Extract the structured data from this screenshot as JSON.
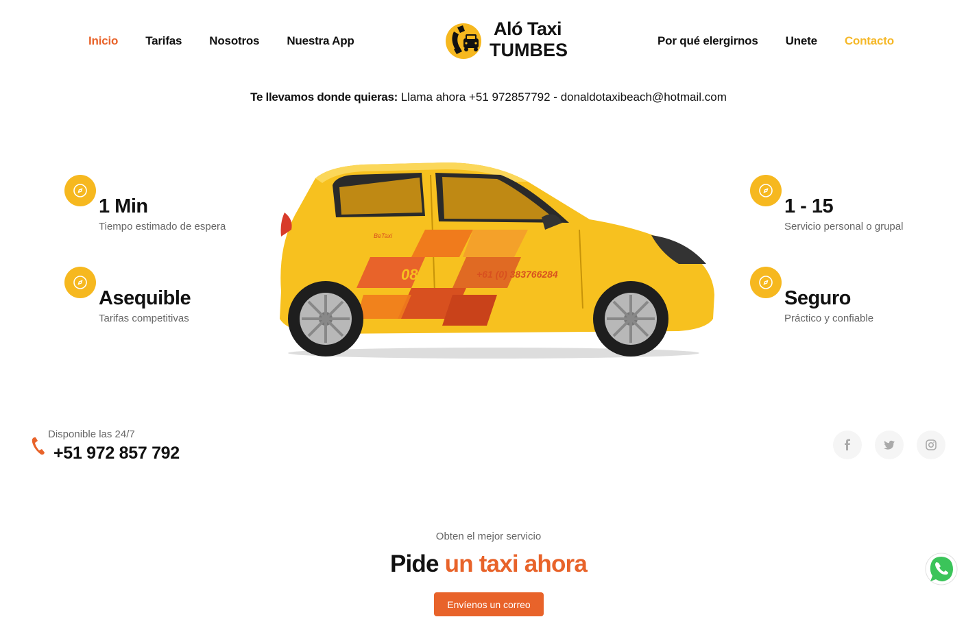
{
  "nav": {
    "left": [
      "Inicio",
      "Tarifas",
      "Nosotros",
      "Nuestra App"
    ],
    "right": [
      "Por qué elergirnos",
      "Unete",
      "Contacto"
    ]
  },
  "logo": {
    "line1": "Aló Taxi",
    "line2": "TUMBES",
    "icon": "taxi-phone-icon"
  },
  "contact": {
    "label": "Te llevamos donde quieras:",
    "text": "Llama ahora +51 972857792 - donaldotaxibeach@hotmail.com"
  },
  "features": [
    {
      "title": "1 Min",
      "subtitle": "Tiempo estimado de espera",
      "icon": "compass-icon"
    },
    {
      "title": "Asequible",
      "subtitle": "Tarifas competitivas",
      "icon": "compass-icon"
    },
    {
      "title": "1 - 15",
      "subtitle": "Servicio personal o grupal",
      "icon": "compass-icon"
    },
    {
      "title": "Seguro",
      "subtitle": "Práctico y confiable",
      "icon": "compass-icon"
    }
  ],
  "car": {
    "brand": "BeTaxi",
    "number": "08",
    "phone": "+61 (0) 383766284"
  },
  "phone_block": {
    "availability": "Disponible las 24/7",
    "number": "+51 972 857 792"
  },
  "socials": [
    "facebook-icon",
    "twitter-icon",
    "instagram-icon"
  ],
  "cta": {
    "eyebrow": "Obten el mejor servicio",
    "title_plain": "Pide",
    "title_accent": "un taxi ahora",
    "button": "Envíenos un correo"
  },
  "colors": {
    "accent": "#e8632a",
    "yellow": "#f6b81f",
    "contact": "#f5b829"
  }
}
